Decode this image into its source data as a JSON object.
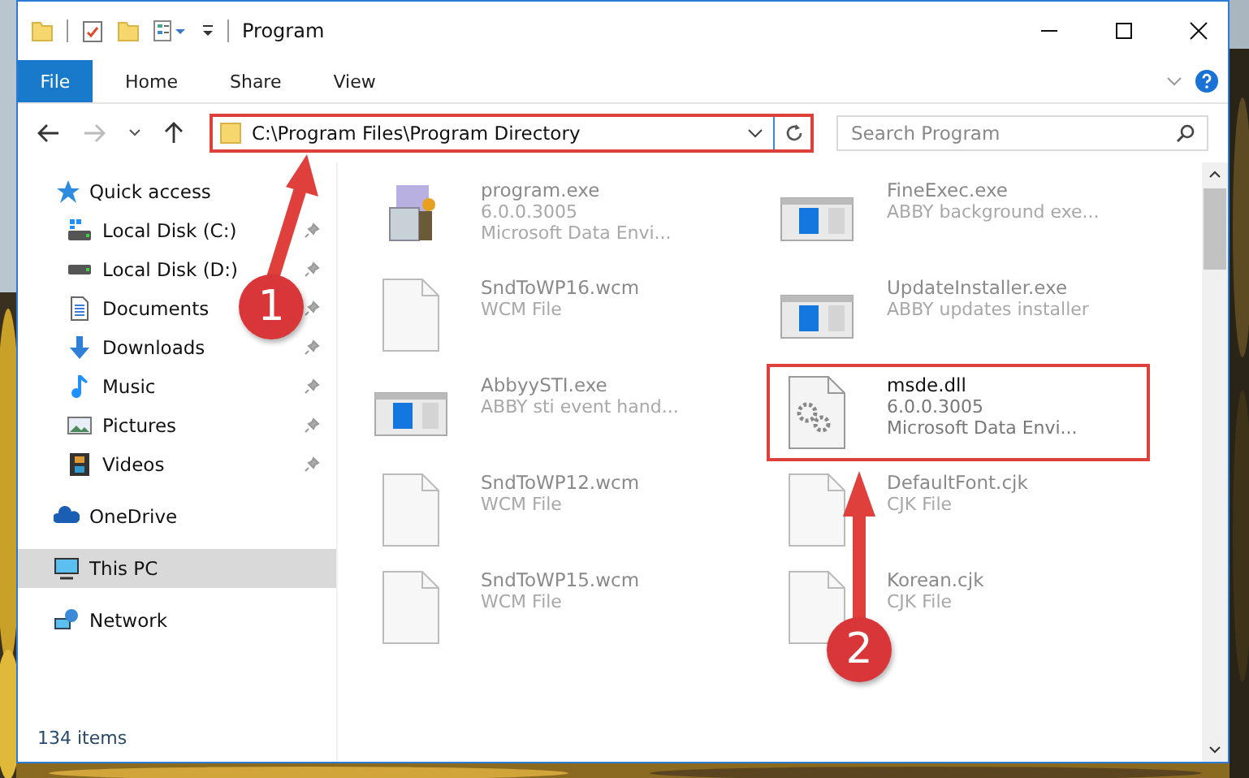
{
  "window": {
    "title": "Program"
  },
  "ribbon_tabs": [
    {
      "label": "File",
      "kind": "file"
    },
    {
      "label": "Home",
      "kind": "tab"
    },
    {
      "label": "Share",
      "kind": "tab"
    },
    {
      "label": "View",
      "kind": "tab"
    }
  ],
  "address": {
    "path": "C:\\Program Files\\Program Directory",
    "highlighted": true
  },
  "search": {
    "placeholder": "Search Program"
  },
  "navigation": [
    {
      "label": "Quick access",
      "selected": false,
      "children": [
        {
          "label": "Local Disk (C:)",
          "pinned": true,
          "selected": false
        },
        {
          "label": "Local Disk (D:)",
          "pinned": true,
          "selected": false
        },
        {
          "label": "Documents",
          "pinned": true,
          "selected": false
        },
        {
          "label": "Downloads",
          "pinned": true,
          "selected": false
        },
        {
          "label": "Music",
          "pinned": true,
          "selected": false
        },
        {
          "label": "Pictures",
          "pinned": true,
          "selected": false
        },
        {
          "label": "Videos",
          "pinned": true,
          "selected": false
        }
      ]
    },
    {
      "label": "OneDrive",
      "selected": false
    },
    {
      "label": "This PC",
      "selected": true
    },
    {
      "label": "Network",
      "selected": false
    }
  ],
  "files": [
    {
      "name": "program.exe",
      "details": [
        "6.0.0.3005",
        "Microsoft Data Envi..."
      ],
      "kind": "installer",
      "dimmed": true,
      "highlighted": false
    },
    {
      "name": "FineExec.exe",
      "details": [
        "ABBY background exe..."
      ],
      "kind": "app",
      "dimmed": true,
      "highlighted": false
    },
    {
      "name": "SndToWP16.wcm",
      "details": [
        "WCM File"
      ],
      "kind": "blank",
      "dimmed": true,
      "highlighted": false
    },
    {
      "name": "UpdateInstaller.exe",
      "details": [
        "ABBY updates installer"
      ],
      "kind": "app",
      "dimmed": true,
      "highlighted": false
    },
    {
      "name": "AbbyySTI.exe",
      "details": [
        "ABBY sti event hand..."
      ],
      "kind": "app",
      "dimmed": true,
      "highlighted": false
    },
    {
      "name": "msde.dll",
      "details": [
        "6.0.0.3005",
        "Microsoft Data Envi..."
      ],
      "kind": "dll",
      "dimmed": false,
      "highlighted": true
    },
    {
      "name": "SndToWP12.wcm",
      "details": [
        "WCM File"
      ],
      "kind": "blank",
      "dimmed": true,
      "highlighted": false
    },
    {
      "name": "DefaultFont.cjk",
      "details": [
        "CJK File"
      ],
      "kind": "blank",
      "dimmed": true,
      "highlighted": false
    },
    {
      "name": "SndToWP15.wcm",
      "details": [
        "WCM File"
      ],
      "kind": "blank",
      "dimmed": true,
      "highlighted": false
    },
    {
      "name": "Korean.cjk",
      "details": [
        "CJK File"
      ],
      "kind": "blank",
      "dimmed": true,
      "highlighted": false
    }
  ],
  "status_bar": {
    "item_count": "134 items"
  },
  "callouts": [
    {
      "label": "1"
    },
    {
      "label": "2"
    }
  ]
}
